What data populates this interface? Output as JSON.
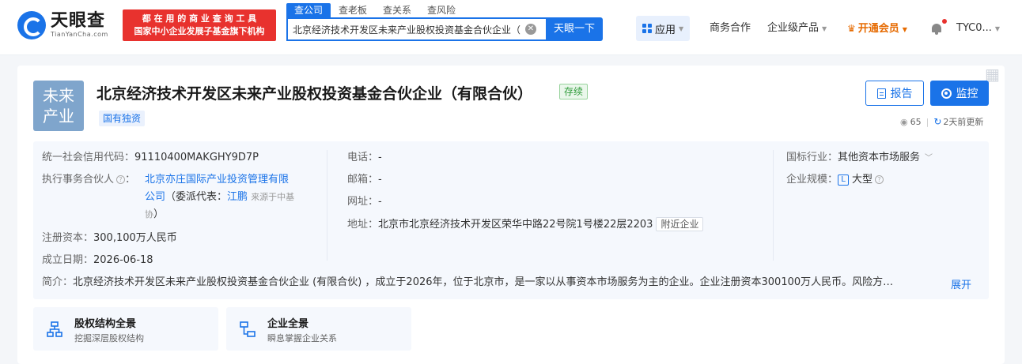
{
  "header": {
    "logo_cn": "天眼查",
    "logo_en": "TianYanCha.com",
    "slogan_line1": "都 在 用 的 商 业 查 询 工 具",
    "slogan_line2": "国家中小企业发展子基金旗下机构",
    "search_tabs": [
      "查公司",
      "查老板",
      "查关系",
      "查风险"
    ],
    "search_value": "北京经济技术开发区未来产业股权投资基金合伙企业（",
    "search_button": "天眼一下",
    "nav_apps": "应用",
    "nav_business": "商务合作",
    "nav_enterprise": "企业级产品",
    "nav_vip": "开通会员",
    "user": "TYC0..."
  },
  "company": {
    "logo_line1": "未来",
    "logo_line2": "产业",
    "name": "北京经济技术开发区未来产业股权投资基金合伙企业（有限合伙）",
    "status": "存续",
    "type_tag": "国有独资",
    "report_button": "报告",
    "monitor_button": "监控",
    "views": "65",
    "updated": "2天前更新"
  },
  "info": {
    "credit_code_label": "统一社会信用代码：",
    "credit_code": "91110400MAKGHY9D7P",
    "partner_label": "执行事务合伙人",
    "partner_line1": "北京亦庄国际产业投资管理有限",
    "partner_line2": "公司",
    "partner_delegate_label": "（委派代表：",
    "partner_delegate": "江鹏",
    "partner_source_a": "来源于中基",
    "partner_source_b": "协",
    "partner_close": "）",
    "capital_label": "注册资本：",
    "capital": "300,100万人民币",
    "founded_label": "成立日期：",
    "founded": "2026-06-18",
    "phone_label": "电话：",
    "phone": "-",
    "email_label": "邮箱：",
    "email": "-",
    "website_label": "网址：",
    "website": "-",
    "address_label": "地址：",
    "address": "北京市北京经济技术开发区荣华中路22号院1号楼22层2203",
    "nearby_tag": "附近企业",
    "industry_label": "国标行业：",
    "industry": "其他资本市场服务",
    "scale_label": "企业规模：",
    "scale_badge": "L",
    "scale": "大型",
    "intro_label": "简介：",
    "intro": "北京经济技术开发区未来产业股权投资基金合伙企业 (有限合伙) ，成立于2026年，位于北京市，是一家以从事资本市场服务为主的企业。企业注册资本300100万人民币。风险方…",
    "expand": "展开"
  },
  "cards": [
    {
      "title": "股权结构全景",
      "subtitle": "挖掘深层股权结构"
    },
    {
      "title": "企业全景",
      "subtitle": "瞬息掌握企业关系"
    }
  ],
  "colors": {
    "accent": "#1a73e8",
    "status_green": "#2f9b3a",
    "vip": "#e66a00"
  }
}
